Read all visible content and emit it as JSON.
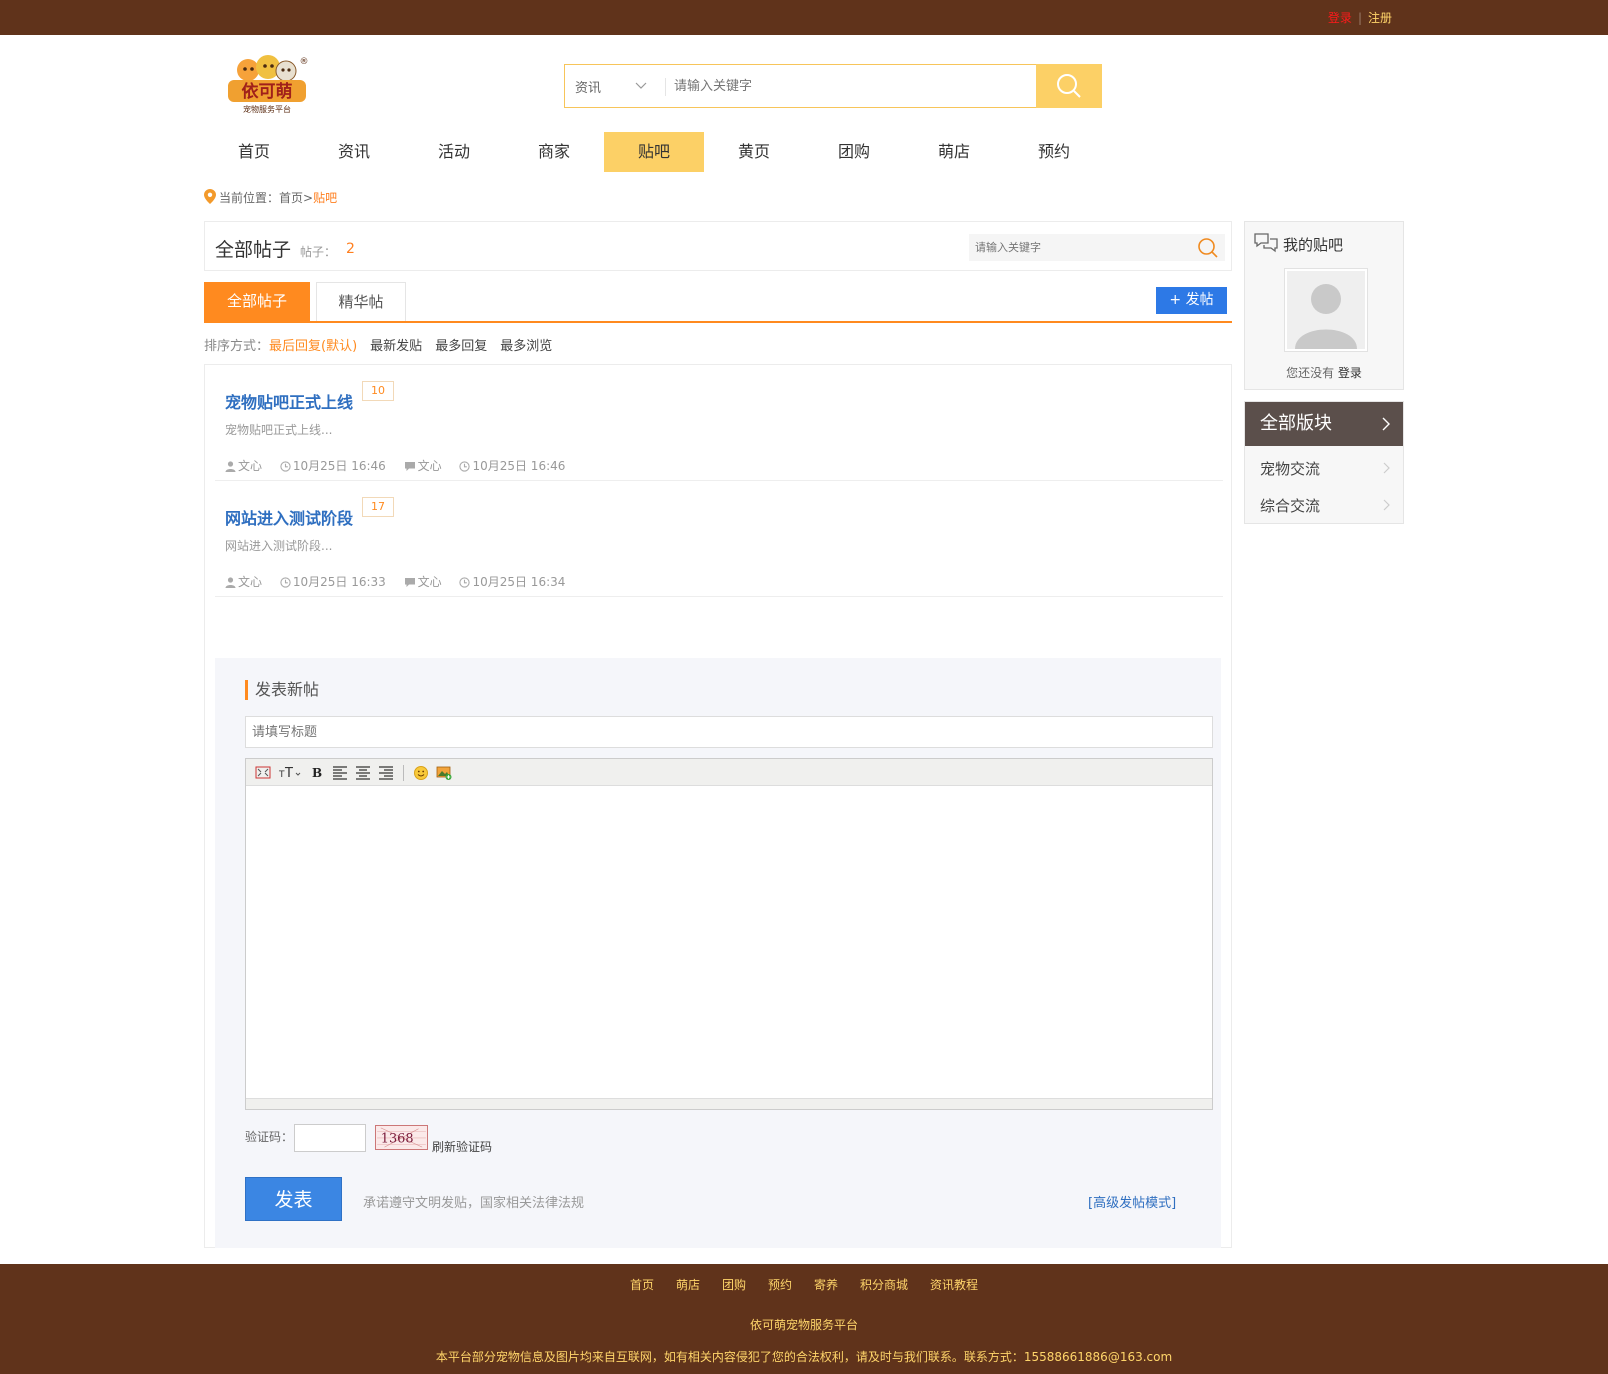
{
  "topbar": {
    "login": "登录",
    "separator": "|",
    "register": "注册"
  },
  "logo": {
    "text": "依可萌",
    "subtitle": "宠物服务平台",
    "registered": "®"
  },
  "search": {
    "category": "资讯",
    "placeholder": "请输入关键字"
  },
  "nav": {
    "items": [
      "首页",
      "资讯",
      "活动",
      "商家",
      "贴吧",
      "黄页",
      "团购",
      "萌店",
      "预约"
    ],
    "active_index": 4
  },
  "breadcrumb": {
    "label": "当前位置：",
    "home": "首页",
    "arrow": ">",
    "current": "贴吧"
  },
  "forum": {
    "title": "全部帖子",
    "count_label": "帖子：",
    "count": "2",
    "search_placeholder": "请输入关键字",
    "tabs": [
      "全部帖子",
      "精华帖"
    ],
    "post_button": "+ 发帖",
    "sort": {
      "label": "排序方式：",
      "options": [
        "最后回复(默认)",
        "最新发贴",
        "最多回复",
        "最多浏览"
      ]
    },
    "posts": [
      {
        "title": "宠物贴吧正式上线",
        "replies": "10",
        "excerpt": "宠物贴吧正式上线...",
        "author": "文心",
        "created": "10月25日 16:46",
        "last_replier": "文心",
        "last_reply": "10月25日 16:46"
      },
      {
        "title": "网站进入测试阶段",
        "replies": "17",
        "excerpt": "网站进入测试阶段...",
        "author": "文心",
        "created": "10月25日 16:33",
        "last_replier": "文心",
        "last_reply": "10月25日 16:34"
      }
    ]
  },
  "compose": {
    "title": "发表新帖",
    "title_placeholder": "请填写标题",
    "captcha_label": "验证码：",
    "captcha_text": "1368",
    "refresh": "刷新验证码",
    "submit": "发表",
    "pledge": "承诺遵守文明发贴，国家相关法律法规",
    "advanced": "[高级发帖模式]"
  },
  "sidebar": {
    "my_bar_title": "我的贴吧",
    "not_logged": "您还没有",
    "login_link": "登录",
    "boards_title": "全部版块",
    "boards": [
      "宠物交流",
      "综合交流"
    ]
  },
  "footer": {
    "links": [
      "首页",
      "萌店",
      "团购",
      "预约",
      "寄养",
      "积分商城",
      "资讯教程"
    ],
    "platform": "依可萌宠物服务平台",
    "notice": "本平台部分宠物信息及图片均来自互联网，如有相关内容侵犯了您的合法权利，请及时与我们联系。联系方式：15588661886@163.com"
  },
  "colors": {
    "brand_brown": "#60331b",
    "accent_orange": "#ff8a1f",
    "accent_yellow": "#fcd066",
    "link_blue": "#2f6fc0",
    "button_blue": "#2d79e6"
  }
}
